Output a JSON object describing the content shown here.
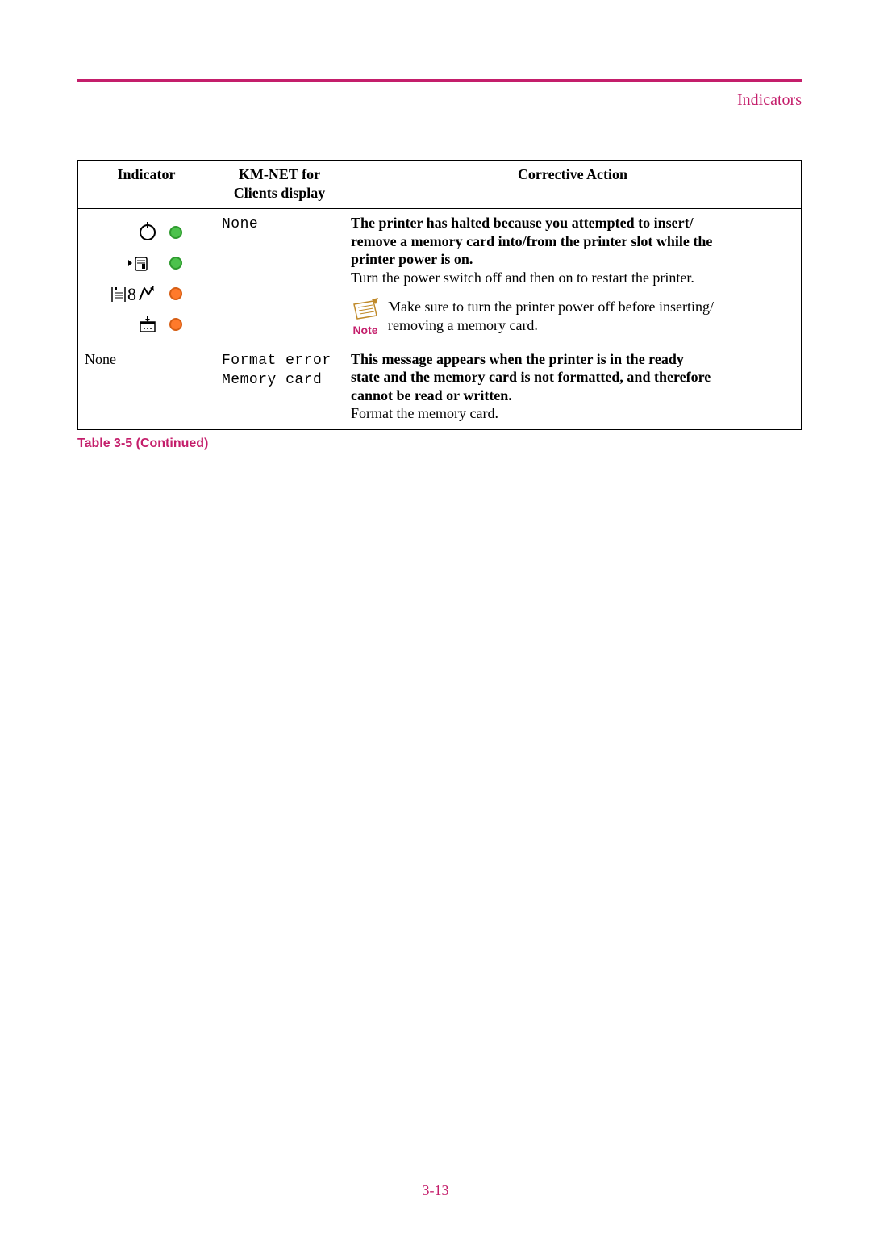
{
  "header": {
    "section_title": "Indicators"
  },
  "table": {
    "headers": {
      "indicator": "Indicator",
      "kmnet_l1": "KM-NET for",
      "kmnet_l2": "Clients display",
      "action": "Corrective Action"
    },
    "row1": {
      "kmnet": "None",
      "bold_l1": "The printer has halted because you attempted to insert/",
      "bold_l2": "remove a memory card into/from the printer slot while the",
      "bold_l3": "printer power is on.",
      "plain": "Turn the power switch off and then on to restart the printer.",
      "note_l1": "Make sure to turn the printer power off before inserting/",
      "note_l2": "removing a memory card.",
      "note_label": "Note"
    },
    "row2": {
      "indicator": "None",
      "kmnet_l1": "Format error",
      "kmnet_l2": "Memory card",
      "bold_l1": "This message appears when the printer is in the ready",
      "bold_l2": "state and the memory card is not formatted, and therefore",
      "bold_l3": "cannot be read or written.",
      "plain": "Format the memory card."
    },
    "caption": "Table 3-5 (Continued)"
  },
  "footer": {
    "page": "3-13"
  }
}
